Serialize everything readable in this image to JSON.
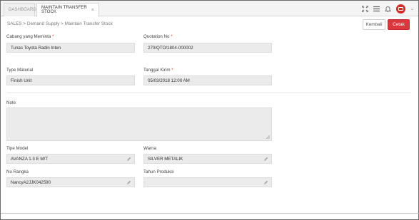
{
  "tabs": [
    {
      "label": "DASHBOARD"
    },
    {
      "label": "MAINTAIN TRANSFER STOCK",
      "close": "×"
    }
  ],
  "icons": {
    "expand": "expand-icon",
    "menu": "menu-icon",
    "bell": "bell-icon",
    "user": "user-avatar-icon",
    "caret": "chevron-down-icon"
  },
  "breadcrumb": "SALES > Demand Supply > Maintain Transfer Stock",
  "buttons": {
    "kembali": "Kembali",
    "cetak": "Cetak"
  },
  "colors": {
    "accent": "#d9363e",
    "field_bg": "#ebebeb"
  },
  "form": {
    "cabang": {
      "label": "Cabang yang Meminta",
      "required": "*",
      "value": "Tunas Toyota Radin Inten"
    },
    "quotation": {
      "label": "Quotation No",
      "required": "*",
      "value": "270/QTO/1804-000002"
    },
    "type_material": {
      "label": "Type Material",
      "value": "Finish Unit"
    },
    "tanggal_kirim": {
      "label": "Tanggal Kirim",
      "required": "*",
      "value": "05/03/2018 12:00 AM"
    },
    "note": {
      "label": "Note",
      "value": ""
    },
    "tipe_model": {
      "label": "Tipe Model",
      "value": "AVANZA 1.3 E M/T"
    },
    "warna": {
      "label": "Warna",
      "value": "SILVER METALIK"
    },
    "no_rangka": {
      "label": "No Rangka",
      "value": "NancyA2JJK042590"
    },
    "tahun_produksi": {
      "label": "Tahun Produksi",
      "value": ""
    }
  }
}
